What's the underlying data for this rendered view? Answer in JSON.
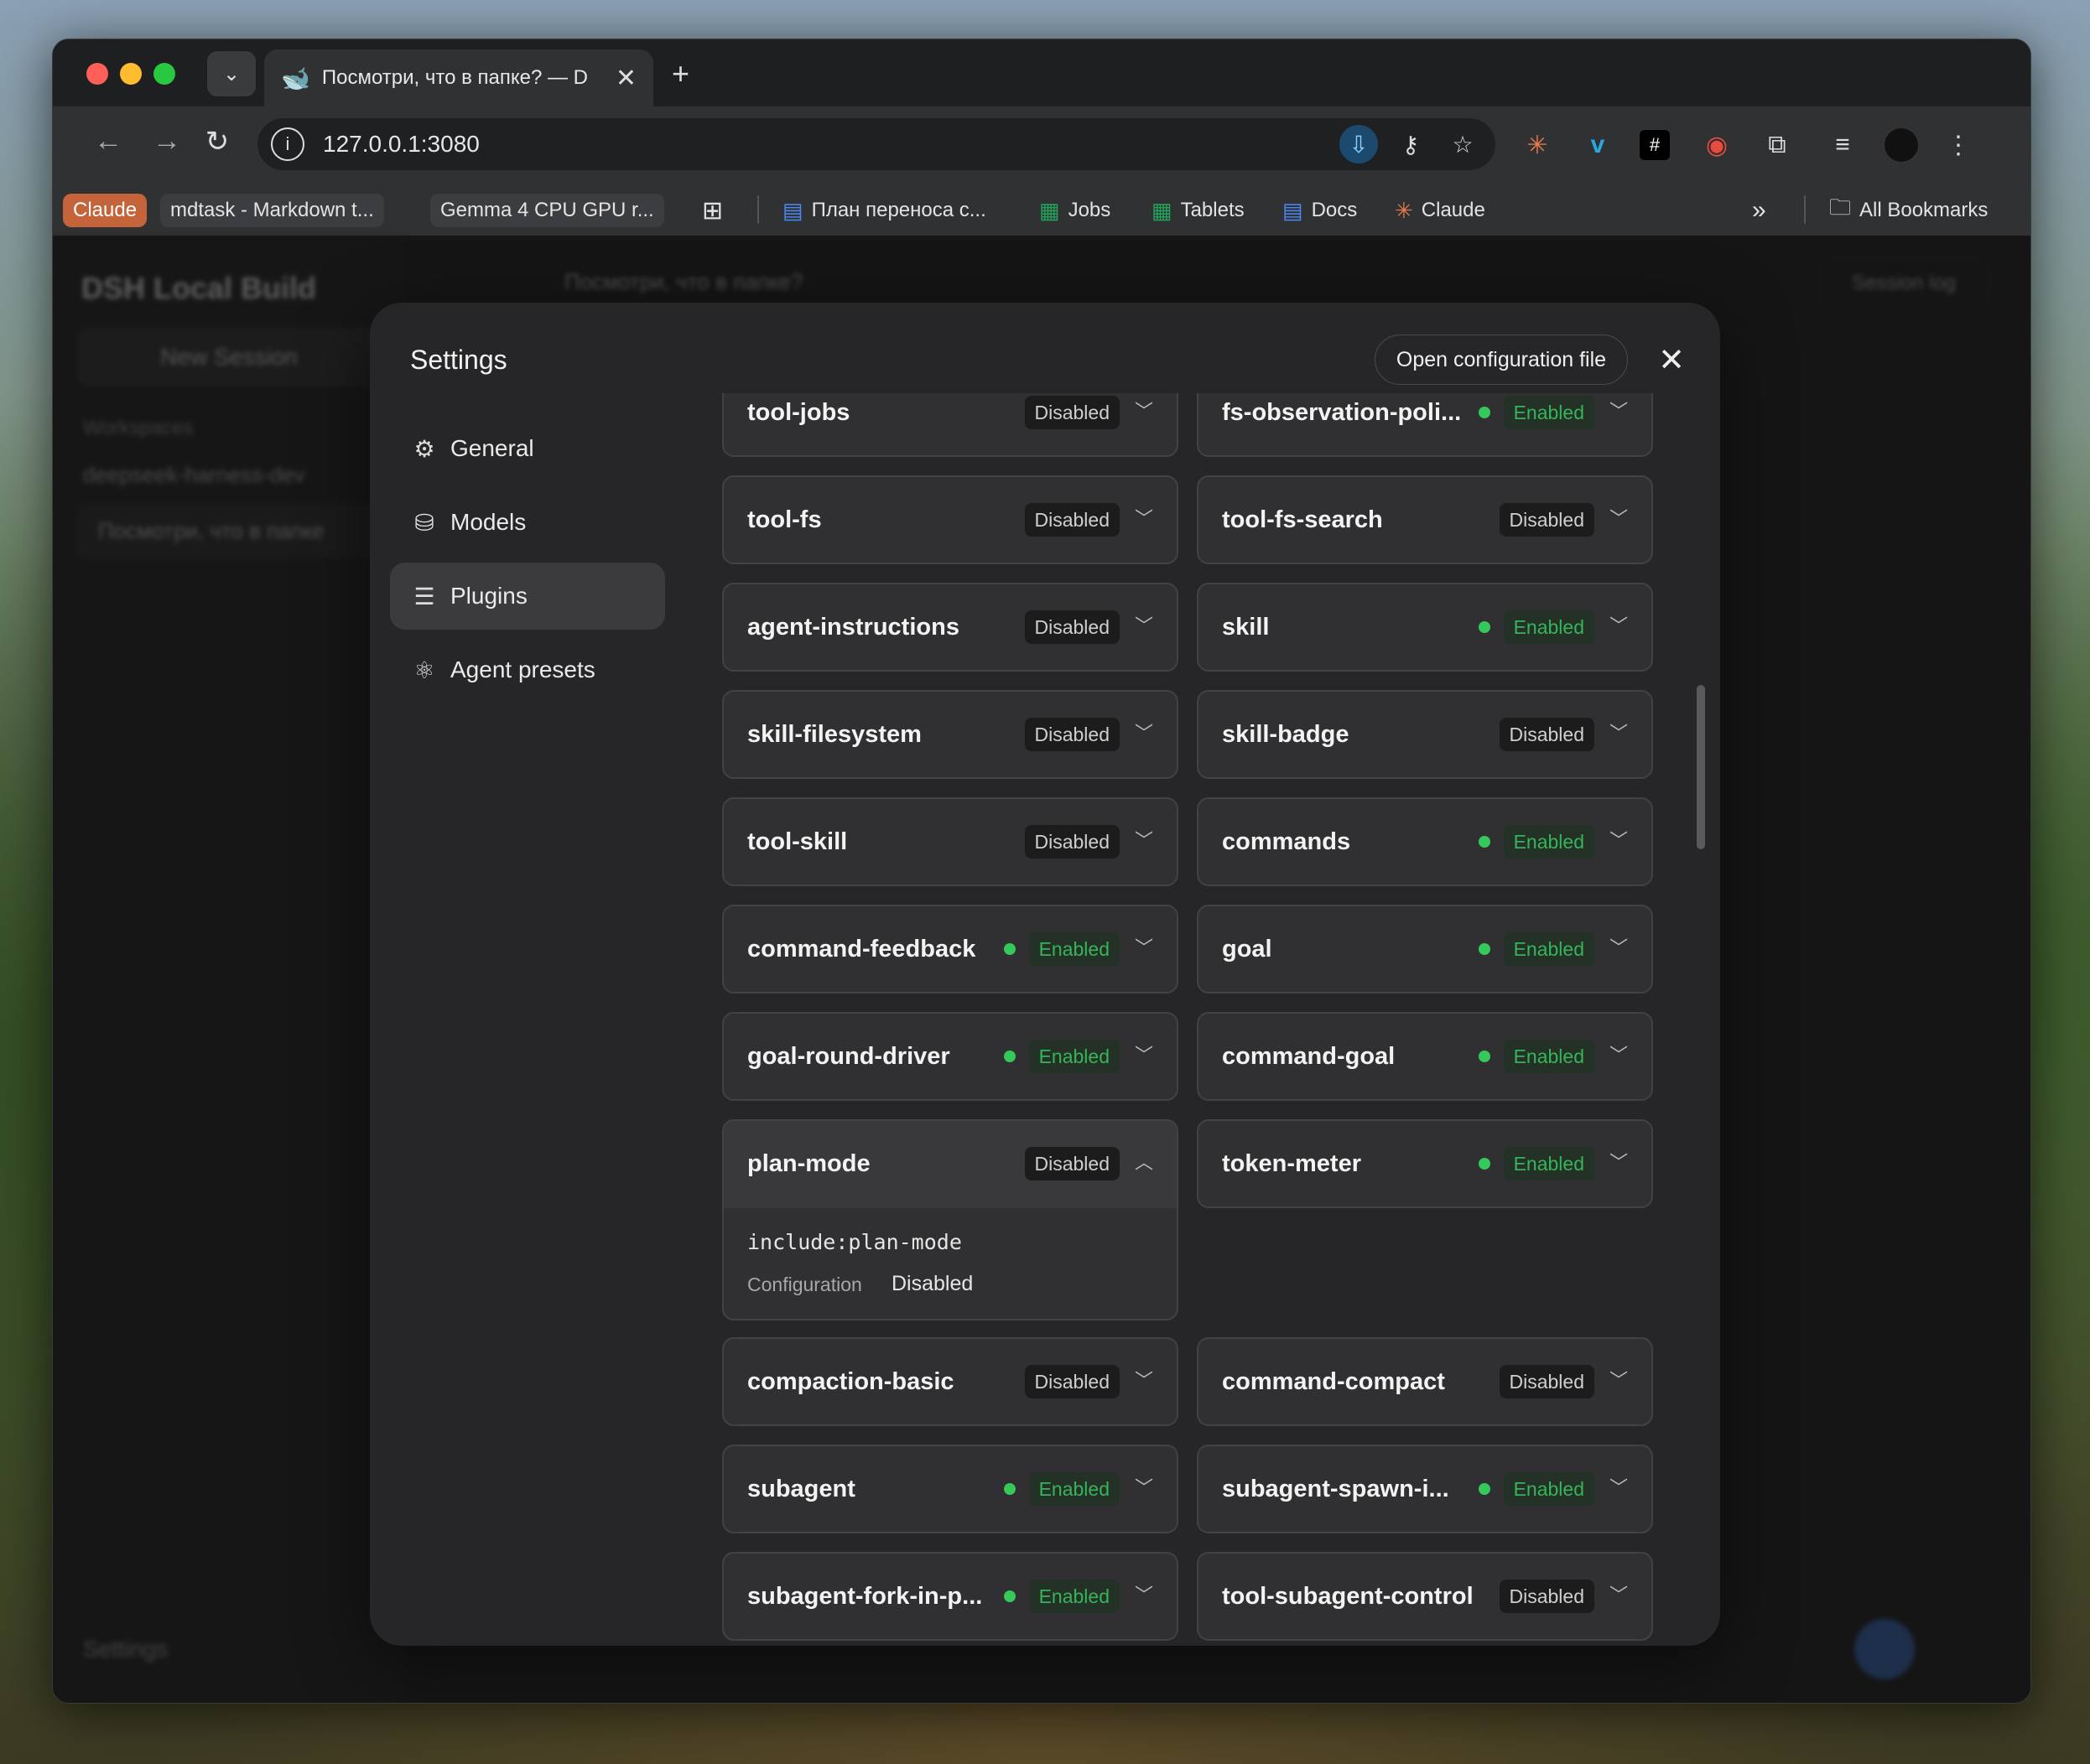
{
  "browser": {
    "tab_title": "Посмотри, что в папке? — D",
    "url": "127.0.0.1:3080",
    "bookmarks": [
      {
        "label": "Claude"
      },
      {
        "label": "mdtask - Markdown t..."
      },
      {
        "label": "Gemma 4 CPU GPU r..."
      },
      {
        "label": "План переноса с..."
      },
      {
        "label": "Jobs"
      },
      {
        "label": "Tablets"
      },
      {
        "label": "Docs"
      },
      {
        "label": "Claude"
      }
    ],
    "all_bookmarks": "All Bookmarks"
  },
  "modal": {
    "title": "Settings",
    "open_config": "Open configuration file",
    "nav": [
      {
        "label": "General",
        "icon": "gear-icon"
      },
      {
        "label": "Models",
        "icon": "database-icon"
      },
      {
        "label": "Plugins",
        "icon": "sliders-icon"
      },
      {
        "label": "Agent presets",
        "icon": "presets-icon"
      }
    ],
    "active_nav": "Plugins"
  },
  "plugins": [
    {
      "name": "tool-jobs",
      "status": "Disabled"
    },
    {
      "name": "fs-observation-poli...",
      "status": "Enabled"
    },
    {
      "name": "tool-fs",
      "status": "Disabled"
    },
    {
      "name": "tool-fs-search",
      "status": "Disabled"
    },
    {
      "name": "agent-instructions",
      "status": "Disabled"
    },
    {
      "name": "skill",
      "status": "Enabled"
    },
    {
      "name": "skill-filesystem",
      "status": "Disabled"
    },
    {
      "name": "skill-badge",
      "status": "Disabled"
    },
    {
      "name": "tool-skill",
      "status": "Disabled"
    },
    {
      "name": "commands",
      "status": "Enabled"
    },
    {
      "name": "command-feedback",
      "status": "Enabled"
    },
    {
      "name": "goal",
      "status": "Enabled"
    },
    {
      "name": "goal-round-driver",
      "status": "Enabled"
    },
    {
      "name": "command-goal",
      "status": "Enabled"
    },
    {
      "name": "plan-mode",
      "status": "Disabled",
      "expanded": true,
      "include": "include:plan-mode",
      "config_label": "Configuration",
      "config_value": "Disabled"
    },
    {
      "name": "token-meter",
      "status": "Enabled"
    },
    {
      "name": "compaction-basic",
      "status": "Disabled"
    },
    {
      "name": "command-compact",
      "status": "Disabled"
    },
    {
      "name": "subagent",
      "status": "Enabled"
    },
    {
      "name": "subagent-spawn-i...",
      "status": "Enabled"
    },
    {
      "name": "subagent-fork-in-p...",
      "status": "Enabled"
    },
    {
      "name": "tool-subagent-control",
      "status": "Disabled"
    }
  ],
  "background_app": {
    "brand": "DSH Local Build",
    "new_session": "New Session",
    "workspaces": "Workspaces",
    "workspace_item": "deepseek-harness-dev",
    "session_item": "Посмотри, что в папке",
    "settings": "Settings",
    "header": "Посмотри, что в папке?",
    "session_log": "Session log"
  }
}
